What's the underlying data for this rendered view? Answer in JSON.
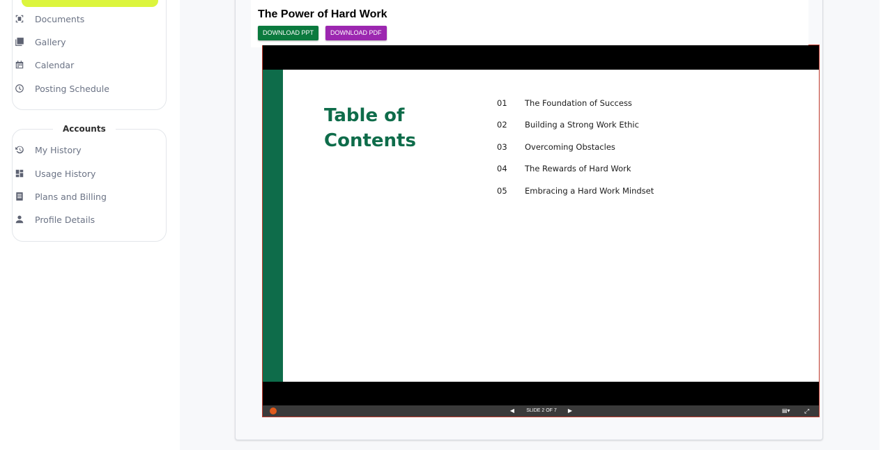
{
  "sidebar": {
    "menu_items": [
      {
        "label": "Documents",
        "icon": "scan-document-icon"
      },
      {
        "label": "Gallery",
        "icon": "image-icon"
      },
      {
        "label": "Calendar",
        "icon": "calendar-icon"
      },
      {
        "label": "Posting Schedule",
        "icon": "clock-icon"
      }
    ],
    "accounts_title": "Accounts",
    "account_items": [
      {
        "label": "My History",
        "icon": "history-icon"
      },
      {
        "label": "Usage History",
        "icon": "dashboard-icon"
      },
      {
        "label": "Plans and Billing",
        "icon": "receipt-icon"
      },
      {
        "label": "Profile Details",
        "icon": "person-icon"
      }
    ],
    "accent_color": "#dcf53d"
  },
  "document": {
    "title": "The Power of Hard Work",
    "download_ppt": "DOWNLOAD PPT",
    "download_pdf": "DOWNLOAD PDF"
  },
  "slide": {
    "heading_line1": "Table of",
    "heading_line2": "Contents",
    "accent_color": "#0e6c4a",
    "toc": [
      {
        "num": "01",
        "text": "The Foundation of Success"
      },
      {
        "num": "02",
        "text": "Building a Strong Work Ethic"
      },
      {
        "num": "03",
        "text": "Overcoming Obstacles"
      },
      {
        "num": "04",
        "text": "The Rewards of Hard Work"
      },
      {
        "num": "05",
        "text": "Embracing a Hard Work Mindset"
      }
    ]
  },
  "viewer": {
    "status": "SLIDE 2 OF 7"
  }
}
